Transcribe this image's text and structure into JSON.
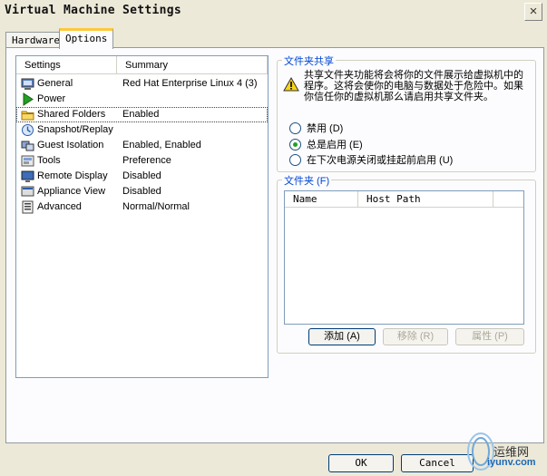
{
  "window": {
    "title": "Virtual Machine Settings"
  },
  "tabs": [
    {
      "label": "Hardware",
      "active": false
    },
    {
      "label": "Options",
      "active": true
    }
  ],
  "settings_list": {
    "columns": [
      "Settings",
      "Summary"
    ],
    "rows": [
      {
        "label": "General",
        "summary": "Red Hat Enterprise Linux 4 (3)",
        "icon": "general-icon",
        "selected": false
      },
      {
        "label": "Power",
        "summary": "",
        "icon": "power-play-icon",
        "selected": false
      },
      {
        "label": "Shared Folders",
        "summary": "Enabled",
        "icon": "shared-folder-icon",
        "selected": true
      },
      {
        "label": "Snapshot/Replay",
        "summary": "",
        "icon": "snapshot-icon",
        "selected": false
      },
      {
        "label": "Guest Isolation",
        "summary": "Enabled, Enabled",
        "icon": "guest-isolation-icon",
        "selected": false
      },
      {
        "label": "Tools",
        "summary": "Preference",
        "icon": "tools-icon",
        "selected": false
      },
      {
        "label": "Remote Display",
        "summary": "Disabled",
        "icon": "remote-display-icon",
        "selected": false
      },
      {
        "label": "Appliance View",
        "summary": "Disabled",
        "icon": "appliance-view-icon",
        "selected": false
      },
      {
        "label": "Advanced",
        "summary": "Normal/Normal",
        "icon": "advanced-icon",
        "selected": false
      }
    ]
  },
  "folder_sharing": {
    "legend": "文件夹共享",
    "warning": "共享文件夹功能将会将你的文件展示给虚拟机中的程序。这将会使你的电脑与数据处于危险中。如果你信任你的虚拟机那么请启用共享文件夹。",
    "options": [
      {
        "label": "禁用 (D)",
        "checked": false
      },
      {
        "label": "总是启用 (E)",
        "checked": true
      },
      {
        "label": "在下次电源关闭或挂起前启用 (U)",
        "checked": false
      }
    ]
  },
  "folders": {
    "legend": "文件夹 (F)",
    "columns": [
      "Name",
      "Host Path"
    ],
    "buttons": {
      "add": "添加 (A)",
      "remove": "移除 (R)",
      "properties": "属性 (P)"
    }
  },
  "footer": {
    "ok": "OK",
    "cancel": "Cancel"
  },
  "watermark": {
    "text": "运维网",
    "url": "iyunv.com"
  },
  "colors": {
    "legend": "#0046d5",
    "tab_highlight": "#ffc83c",
    "radio_on": "#21a121",
    "dialog_bg": "#ece9d8"
  }
}
